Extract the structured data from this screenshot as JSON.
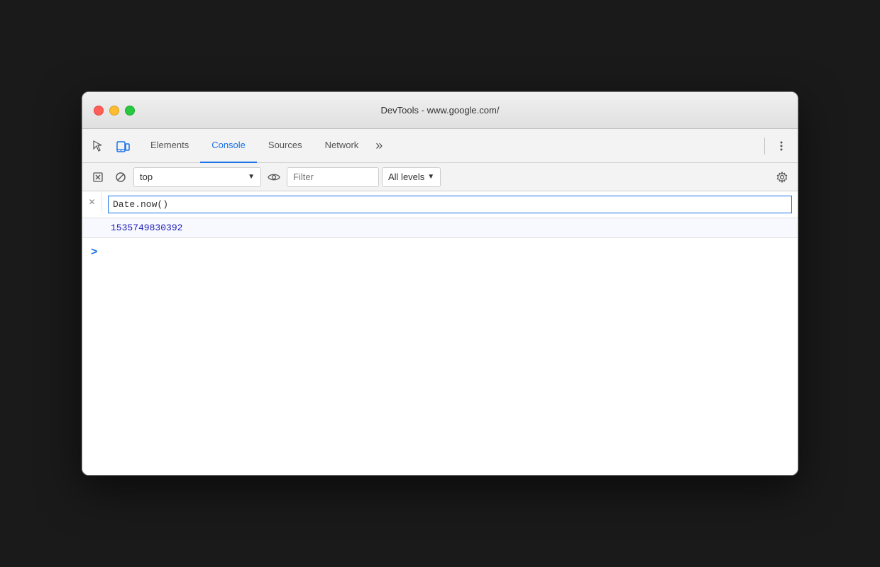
{
  "window": {
    "title": "DevTools - www.google.com/"
  },
  "traffic_lights": {
    "close_label": "close",
    "minimize_label": "minimize",
    "maximize_label": "maximize"
  },
  "tabs": [
    {
      "id": "elements",
      "label": "Elements",
      "active": false
    },
    {
      "id": "console",
      "label": "Console",
      "active": true
    },
    {
      "id": "sources",
      "label": "Sources",
      "active": false
    },
    {
      "id": "network",
      "label": "Network",
      "active": false
    }
  ],
  "tab_more_label": "»",
  "toolbar": {
    "context_selector": "top",
    "filter_placeholder": "Filter",
    "levels_label": "All levels"
  },
  "console": {
    "command": "Date.now()",
    "result": "1535749830392",
    "prompt_arrow": ">"
  },
  "icons": {
    "inspect": "inspect-icon",
    "device": "device-toggle-icon",
    "clear": "clear-console-icon",
    "eye": "live-expressions-icon",
    "gear": "settings-icon",
    "chevron_down": "▾",
    "close": "✕"
  }
}
